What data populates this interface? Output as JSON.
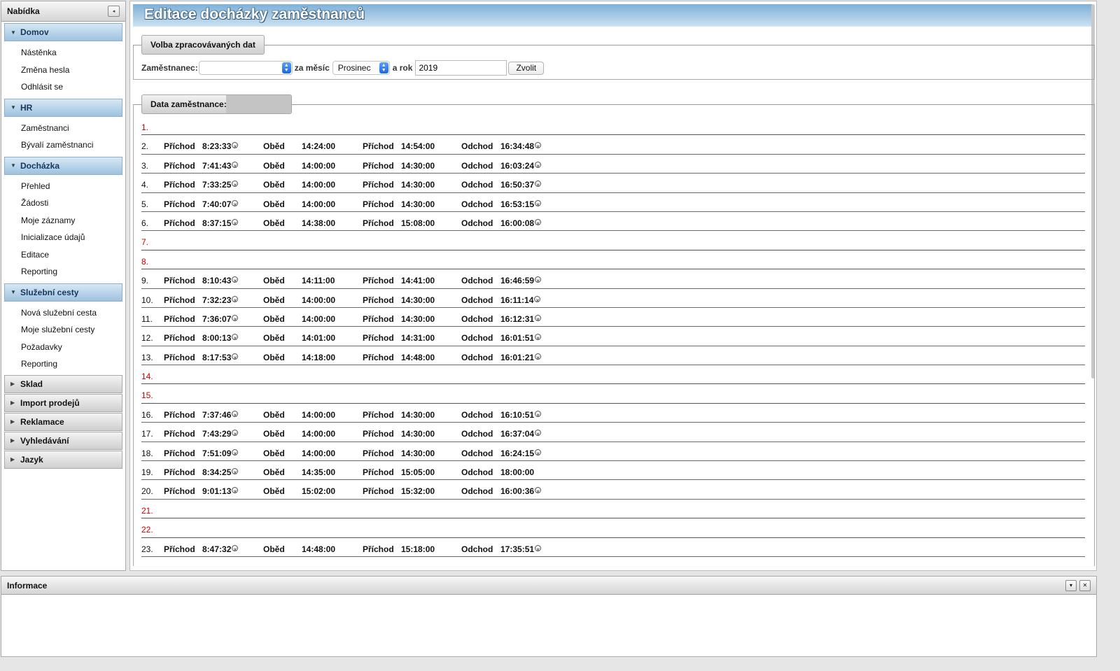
{
  "sidebar": {
    "title": "Nabídka",
    "collapse_icon": "◂",
    "sections": [
      {
        "label": "Domov",
        "open": true,
        "items": [
          "Nástěnka",
          "Změna hesla",
          "Odhlásit se"
        ]
      },
      {
        "label": "HR",
        "open": true,
        "items": [
          "Zaměstnanci",
          "Bývalí zaměstnanci"
        ]
      },
      {
        "label": "Docházka",
        "open": true,
        "items": [
          "Přehled",
          "Žádosti",
          "Moje záznamy",
          "Inicializace údajů",
          "Editace",
          "Reporting"
        ]
      },
      {
        "label": "Služební cesty",
        "open": true,
        "items": [
          "Nová služební cesta",
          "Moje služební cesty",
          "Požadavky",
          "Reporting"
        ]
      },
      {
        "label": "Sklad",
        "open": false,
        "items": []
      },
      {
        "label": "Import prodejů",
        "open": false,
        "items": []
      },
      {
        "label": "Reklamace",
        "open": false,
        "items": []
      },
      {
        "label": "Vyhledávání",
        "open": false,
        "items": []
      },
      {
        "label": "Jazyk",
        "open": false,
        "items": []
      }
    ]
  },
  "main": {
    "title": "Editace docházky zaměstnanců",
    "selection": {
      "legend": "Volba zpracovávaných dat",
      "employee_label": "Zaměstnanec:",
      "employee_value": "",
      "month_label": "za měsíc",
      "month_value": "Prosinec",
      "year_label": "a rok",
      "year_value": "2019",
      "submit_label": "Zvolit"
    },
    "data_legend": "Data zaměstnance:",
    "labels": {
      "arrival": "Příchod",
      "lunch": "Oběd",
      "departure": "Odchod"
    },
    "rows": [
      {
        "day": "1."
      },
      {
        "day": "2.",
        "in": "8:23:33",
        "in_x": true,
        "lunch": "14:24:00",
        "back": "14:54:00",
        "out": "16:34:48",
        "out_x": true
      },
      {
        "day": "3.",
        "in": "7:41:43",
        "in_x": true,
        "lunch": "14:00:00",
        "back": "14:30:00",
        "out": "16:03:24",
        "out_x": true
      },
      {
        "day": "4.",
        "in": "7:33:25",
        "in_x": true,
        "lunch": "14:00:00",
        "back": "14:30:00",
        "out": "16:50:37",
        "out_x": true
      },
      {
        "day": "5.",
        "in": "7:40:07",
        "in_x": true,
        "lunch": "14:00:00",
        "back": "14:30:00",
        "out": "16:53:15",
        "out_x": true
      },
      {
        "day": "6.",
        "in": "8:37:15",
        "in_x": true,
        "lunch": "14:38:00",
        "back": "15:08:00",
        "out": "16:00:08",
        "out_x": true
      },
      {
        "day": "7."
      },
      {
        "day": "8."
      },
      {
        "day": "9.",
        "in": "8:10:43",
        "in_x": true,
        "lunch": "14:11:00",
        "back": "14:41:00",
        "out": "16:46:59",
        "out_x": true
      },
      {
        "day": "10.",
        "in": "7:32:23",
        "in_x": true,
        "lunch": "14:00:00",
        "back": "14:30:00",
        "out": "16:11:14",
        "out_x": true
      },
      {
        "day": "11.",
        "in": "7:36:07",
        "in_x": true,
        "lunch": "14:00:00",
        "back": "14:30:00",
        "out": "16:12:31",
        "out_x": true
      },
      {
        "day": "12.",
        "in": "8:00:13",
        "in_x": true,
        "lunch": "14:01:00",
        "back": "14:31:00",
        "out": "16:01:51",
        "out_x": true
      },
      {
        "day": "13.",
        "in": "8:17:53",
        "in_x": true,
        "lunch": "14:18:00",
        "back": "14:48:00",
        "out": "16:01:21",
        "out_x": true
      },
      {
        "day": "14."
      },
      {
        "day": "15."
      },
      {
        "day": "16.",
        "in": "7:37:46",
        "in_x": true,
        "lunch": "14:00:00",
        "back": "14:30:00",
        "out": "16:10:51",
        "out_x": true
      },
      {
        "day": "17.",
        "in": "7:43:29",
        "in_x": true,
        "lunch": "14:00:00",
        "back": "14:30:00",
        "out": "16:37:04",
        "out_x": true
      },
      {
        "day": "18.",
        "in": "7:51:09",
        "in_x": true,
        "lunch": "14:00:00",
        "back": "14:30:00",
        "out": "16:24:15",
        "out_x": true
      },
      {
        "day": "19.",
        "in": "8:34:25",
        "in_x": true,
        "lunch": "14:35:00",
        "back": "15:05:00",
        "out": "18:00:00",
        "out_x": false
      },
      {
        "day": "20.",
        "in": "9:01:13",
        "in_x": true,
        "lunch": "15:02:00",
        "back": "15:32:00",
        "out": "16:00:36",
        "out_x": true
      },
      {
        "day": "21."
      },
      {
        "day": "22."
      },
      {
        "day": "23.",
        "in": "8:47:32",
        "in_x": true,
        "lunch": "14:48:00",
        "back": "15:18:00",
        "out": "17:35:51",
        "out_x": true
      }
    ]
  },
  "info_panel": {
    "title": "Informace",
    "buttons": [
      "▾",
      "✕"
    ]
  },
  "icons": {
    "delete": "delete-icon",
    "section_open": "triangle-down-icon",
    "section_closed": "triangle-right-icon"
  }
}
